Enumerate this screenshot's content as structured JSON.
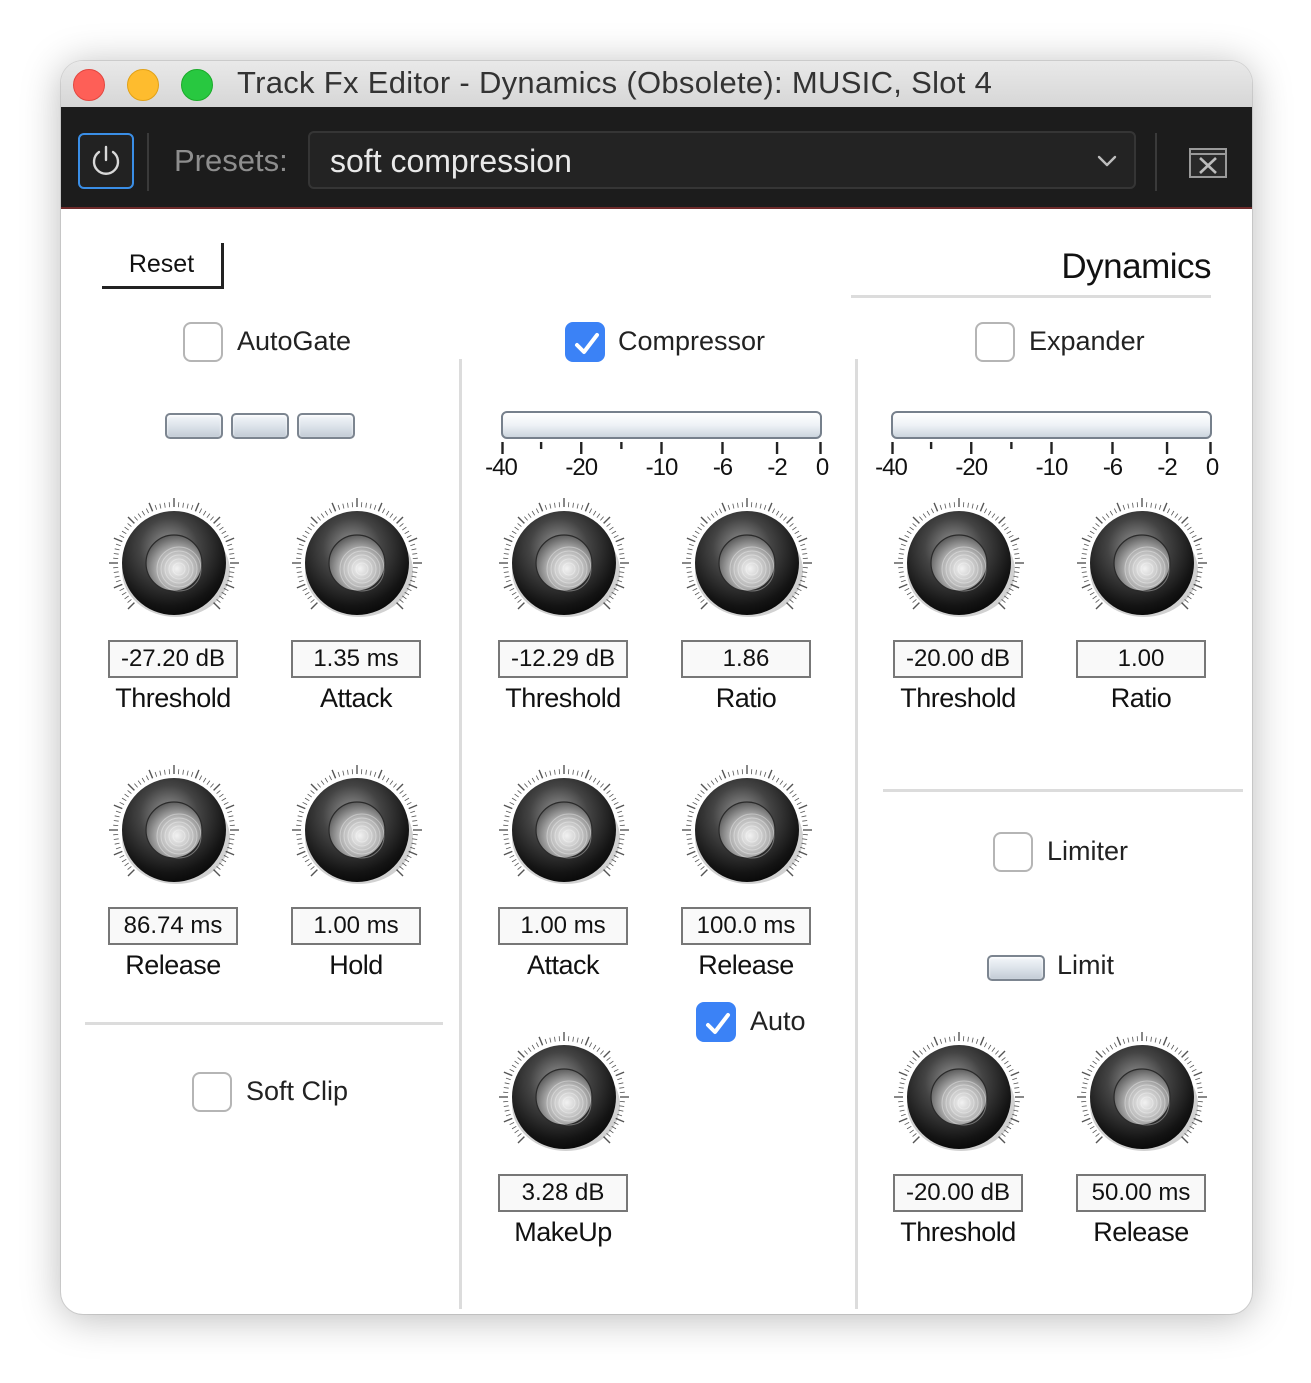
{
  "window": {
    "title": "Track Fx Editor - Dynamics (Obsolete): MUSIC, Slot 4"
  },
  "toolbar": {
    "presets_label": "Presets:",
    "preset_value": "soft compression"
  },
  "header": {
    "reset_label": "Reset",
    "plugin_title": "Dynamics"
  },
  "meter_scale": [
    "-40",
    "-20",
    "-10",
    "-6",
    "-2",
    "0"
  ],
  "autogate": {
    "label": "AutoGate",
    "checked": false,
    "threshold": {
      "value": "-27.20 dB",
      "label": "Threshold"
    },
    "attack": {
      "value": "1.35 ms",
      "label": "Attack"
    },
    "release": {
      "value": "86.74 ms",
      "label": "Release"
    },
    "hold": {
      "value": "1.00 ms",
      "label": "Hold"
    }
  },
  "softclip": {
    "label": "Soft Clip",
    "checked": false
  },
  "compressor": {
    "label": "Compressor",
    "checked": true,
    "threshold": {
      "value": "-12.29 dB",
      "label": "Threshold"
    },
    "ratio": {
      "value": "1.86",
      "label": "Ratio"
    },
    "attack": {
      "value": "1.00 ms",
      "label": "Attack"
    },
    "release": {
      "value": "100.0 ms",
      "label": "Release"
    },
    "auto": {
      "label": "Auto",
      "checked": true
    },
    "makeup": {
      "value": "3.28 dB",
      "label": "MakeUp"
    }
  },
  "expander": {
    "label": "Expander",
    "checked": false,
    "threshold": {
      "value": "-20.00 dB",
      "label": "Threshold"
    },
    "ratio": {
      "value": "1.00",
      "label": "Ratio"
    }
  },
  "limiter": {
    "label": "Limiter",
    "checked": false,
    "limit_label": "Limit",
    "threshold": {
      "value": "-20.00 dB",
      "label": "Threshold"
    },
    "release": {
      "value": "50.00 ms",
      "label": "Release"
    }
  },
  "colors": {
    "accent": "#3b82f6",
    "toolbar_bg": "#1c1c1c",
    "traffic_red": "#fe5f57",
    "traffic_yellow": "#febc2e",
    "traffic_green": "#28c840"
  }
}
